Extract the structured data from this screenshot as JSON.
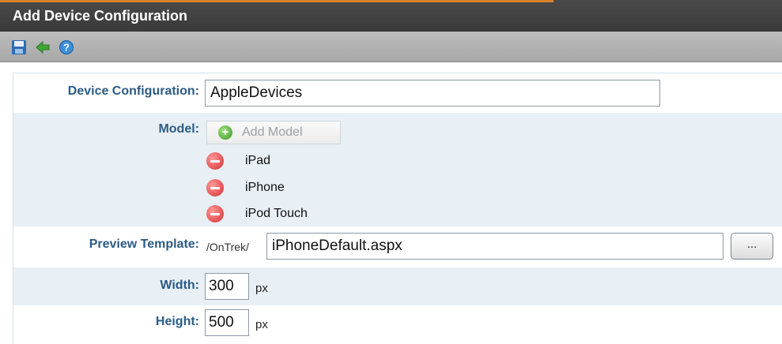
{
  "window": {
    "title": "Add Device Configuration"
  },
  "toolbar": {
    "icons": [
      "save-icon",
      "back-arrow-icon",
      "help-icon"
    ],
    "colors": {
      "save": "#2e6db4",
      "back": "#3fa535",
      "help": "#3a8fd9"
    }
  },
  "form": {
    "device_configuration": {
      "label": "Device Configuration:",
      "value": "AppleDevices"
    },
    "model": {
      "label": "Model:",
      "add_button": "Add Model",
      "items": [
        "iPad",
        "iPhone",
        "iPod Touch"
      ]
    },
    "preview_template": {
      "label": "Preview Template:",
      "prefix": "/OnTrek/",
      "value": "iPhoneDefault.aspx",
      "browse": "..."
    },
    "width": {
      "label": "Width:",
      "value": "300",
      "unit": "px"
    },
    "height": {
      "label": "Height:",
      "value": "500",
      "unit": "px"
    }
  },
  "colors": {
    "label": "#2b5b86",
    "alt_row": "#e8eff5",
    "titlebar": "#3f3f3f",
    "accent": "#d9822b"
  }
}
